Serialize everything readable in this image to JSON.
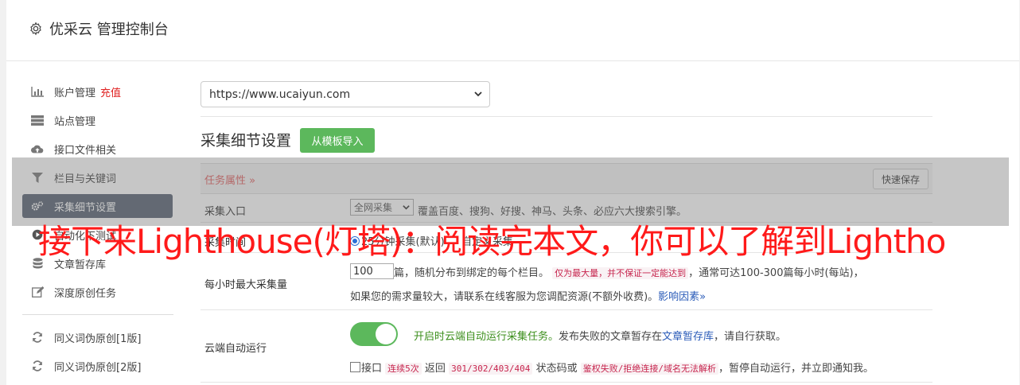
{
  "header": {
    "title": "优采云 管理控制台",
    "icon": "gear-icon"
  },
  "sidebar": {
    "items": [
      {
        "label": "账户管理",
        "badge": "充值",
        "icon": "bar-chart-icon"
      },
      {
        "label": "站点管理",
        "icon": "server-icon"
      },
      {
        "label": "接口文件相关",
        "icon": "cloud-upload-icon"
      },
      {
        "label": "栏目与关键词",
        "icon": "filter-icon"
      },
      {
        "label": "采集细节设置",
        "icon": "cogs-icon",
        "active": true
      },
      {
        "label": "自动化下测试",
        "icon": "play-circle-icon"
      },
      {
        "label": "文章暂存库",
        "icon": "database-icon"
      },
      {
        "label": "深度原创任务",
        "icon": "edit-icon"
      },
      {
        "label": "同义词伪原创[1版]",
        "icon": "refresh-icon"
      },
      {
        "label": "同义词伪原创[2版]",
        "icon": "refresh-icon"
      }
    ]
  },
  "main": {
    "site_select": "https://www.ucaiyun.com",
    "section_title": "采集细节设置",
    "template_button": "从模板导入",
    "task_attr": "任务属性 »",
    "quick_save": "快速保存",
    "rows": {
      "collect_entry": {
        "label": "采集入口",
        "select_value": "全网采集",
        "desc": "覆盖百度、搜狗、好搜、神马、头条、必应六大搜索引擎。"
      },
      "collect_time": {
        "label": "采集时间",
        "option1": "25分钟采集(默认)",
        "option2": "自定义采集"
      },
      "max_per_hour": {
        "label": "每小时最大采集量",
        "input_value": "100",
        "text1": "篇，随机分布到绑定的每个栏目。",
        "code1": "仅为最大量，并不保证一定能达到",
        "text2": "，通常可达100-300篇每小时(每站)，",
        "text3": "如果您的需求量较大，请联系在线客服为您调配资源(不额外收费)。",
        "link": "影响因素»"
      },
      "cloud_run": {
        "label": "云端自动运行",
        "toggle_on": true,
        "green_text": "开启时云端自动运行采集任务。",
        "text1": "发布失败的文章暂存在",
        "link": "文章暂存库",
        "text2": "，请自行获取。",
        "check_label": "接口",
        "code1": "连续5次",
        "text3": "返回",
        "code2": "301/302/403/404",
        "text4": "状态码或",
        "code3": "鉴权失败/拒绝连接/域名无法解析",
        "text5": "，暂停自动运行，并立即通知我。"
      }
    }
  },
  "overlay_text": "接下来Lighthouse(灯塔)：阅读完本文，你可以了解到Lightho",
  "colors": {
    "active_bg": "#556070",
    "green": "#5cb85c",
    "red": "#e02020",
    "overlay": "#ff1a1a"
  }
}
